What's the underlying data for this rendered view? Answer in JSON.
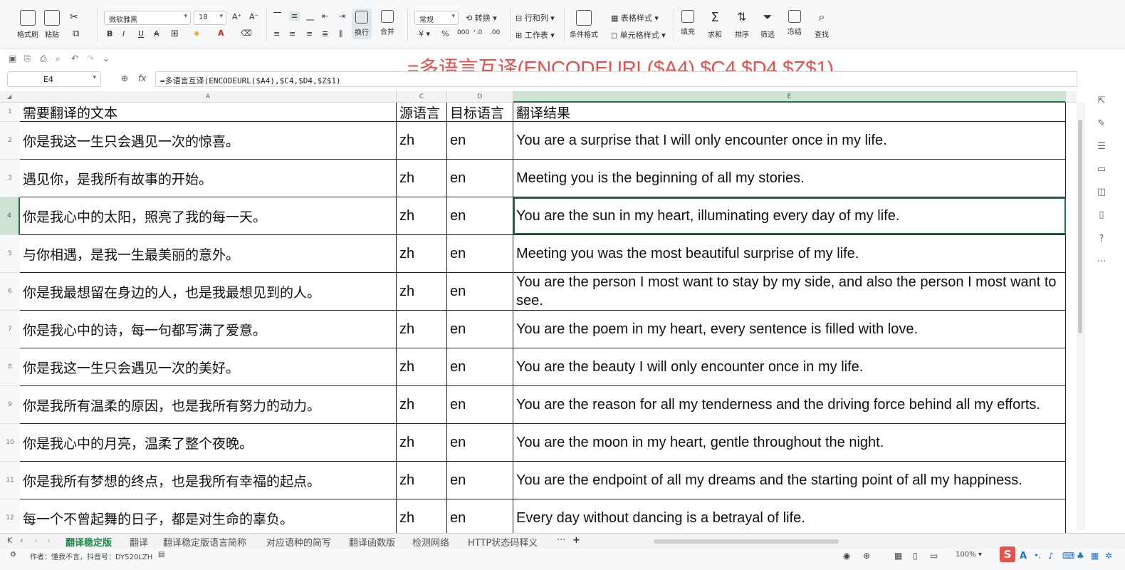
{
  "ribbon": {
    "clip_group": [
      "格式刷",
      "粘贴"
    ],
    "font_name": "微软雅黑",
    "font_size": "18",
    "wrap_label": "换行",
    "merge_label": "合并",
    "number_format": "常规",
    "convert_label": "转换",
    "rowcol_label": "行和列",
    "worksheet_label": "工作表",
    "cond_format_label": "条件格式",
    "table_style_label": "表格样式",
    "cell_style_label": "单元格样式",
    "fill_label": "填充",
    "sum_label": "求和",
    "sort_label": "排序",
    "filter_label": "筛选",
    "freeze_label": "冻结",
    "find_label": "查找"
  },
  "formula_overlay": "=多语言互译(ENCODEURL($A4),$C4,$D4,$Z$1)",
  "formula_bar": {
    "cell_ref": "E4",
    "fx": "fx",
    "formula": "=多语言互译(ENCODEURL($A4),$C4,$D4,$Z$1)"
  },
  "columns": [
    "A",
    "C",
    "D",
    "E"
  ],
  "rows": [
    {
      "num": "1",
      "a": "需要翻译的文本",
      "c": "源语言",
      "d": "目标语言",
      "e": "翻译结果"
    },
    {
      "num": "2",
      "a": "你是我这一生只会遇见一次的惊喜。",
      "c": "zh",
      "d": "en",
      "e": "You are a surprise that I will only encounter once in my life."
    },
    {
      "num": "3",
      "a": "遇见你，是我所有故事的开始。",
      "c": "zh",
      "d": "en",
      "e": "Meeting you is the beginning of all my stories."
    },
    {
      "num": "4",
      "a": "你是我心中的太阳，照亮了我的每一天。",
      "c": "zh",
      "d": "en",
      "e": "You are the sun in my heart, illuminating every day of my life."
    },
    {
      "num": "5",
      "a": "与你相遇，是我一生最美丽的意外。",
      "c": "zh",
      "d": "en",
      "e": "Meeting you was the most beautiful surprise of my life."
    },
    {
      "num": "6",
      "a": "你是我最想留在身边的人，也是我最想见到的人。",
      "c": "zh",
      "d": "en",
      "e": "You are the person I most want to stay by my side, and also the person I most want to see."
    },
    {
      "num": "7",
      "a": "你是我心中的诗，每一句都写满了爱意。",
      "c": "zh",
      "d": "en",
      "e": "You are the poem in my heart, every sentence is filled with love."
    },
    {
      "num": "8",
      "a": "你是我这一生只会遇见一次的美好。",
      "c": "zh",
      "d": "en",
      "e": "You are the beauty I will only encounter once in my life."
    },
    {
      "num": "9",
      "a": "你是我所有温柔的原因，也是我所有努力的动力。",
      "c": "zh",
      "d": "en",
      "e": "You are the reason for all my tenderness and the driving force behind all my efforts."
    },
    {
      "num": "10",
      "a": "你是我心中的月亮，温柔了整个夜晚。",
      "c": "zh",
      "d": "en",
      "e": "You are the moon in my heart, gentle throughout the night."
    },
    {
      "num": "11",
      "a": "你是我所有梦想的终点，也是我所有幸福的起点。",
      "c": "zh",
      "d": "en",
      "e": "You are the endpoint of all my dreams and the starting point of all my happiness."
    },
    {
      "num": "12",
      "a": "每一个不曾起舞的日子，都是对生命的辜负。",
      "c": "zh",
      "d": "en",
      "e": "Every day without dancing is a betrayal of life."
    }
  ],
  "sheet_tabs": [
    "翻译稳定版",
    "翻译",
    "翻译稳定版语言简称",
    "对应语种的简写",
    "翻译函数版",
    "检测网络",
    "HTTP状态码释义"
  ],
  "tabs_more": "···",
  "tabs_add": "+",
  "status": {
    "author": "作者：懂我不言，抖音号：DY520LZH",
    "zoom": "100%"
  },
  "colors": {
    "accent": "#217346",
    "overlay": "#e8504a",
    "active_tab": "#1e8a49"
  }
}
